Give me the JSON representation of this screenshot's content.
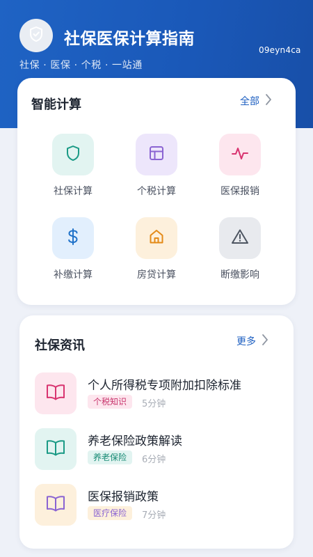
{
  "header": {
    "title": "社保医保计算指南",
    "subtitle": "社保 · 医保 · 个税 · 一站通",
    "app_id": "09eyn4ca",
    "logo_icon": "shield-icon"
  },
  "smart_calc": {
    "title": "智能计算",
    "more_label": "全部",
    "items": [
      {
        "label": "社保计算",
        "icon": "shield-icon",
        "color": "#1a9a85",
        "bg": "#e2f4f1"
      },
      {
        "label": "个税计算",
        "icon": "grid-icon",
        "color": "#8a63d2",
        "bg": "#ede6fb"
      },
      {
        "label": "医保报销",
        "icon": "pulse-icon",
        "color": "#d8336f",
        "bg": "#fde6ee"
      },
      {
        "label": "补缴计算",
        "icon": "dollar-icon",
        "color": "#2072c9",
        "bg": "#e2effd"
      },
      {
        "label": "房贷计算",
        "icon": "home-icon",
        "color": "#e48a17",
        "bg": "#fdf0dc"
      },
      {
        "label": "断缴影响",
        "icon": "warning-icon",
        "color": "#4d5561",
        "bg": "#e8eaee"
      }
    ]
  },
  "news": {
    "title": "社保资讯",
    "more_label": "更多",
    "items": [
      {
        "title": "个人所得税专项附加扣除标准",
        "tag": "个税知识",
        "read_time": "5分钟",
        "icon": "book-icon",
        "color": "#d8336f",
        "bg": "#fde6ee",
        "tag_color": "#c8346c",
        "tag_bg": "#fde6ee"
      },
      {
        "title": "养老保险政策解读",
        "tag": "养老保险",
        "read_time": "6分钟",
        "icon": "book-icon",
        "color": "#1a9a85",
        "bg": "#e2f4f1",
        "tag_color": "#178a74",
        "tag_bg": "#e2f4f1"
      },
      {
        "title": "医保报销政策",
        "tag": "医疗保险",
        "read_time": "7分钟",
        "icon": "book-icon",
        "color": "#8a63d2",
        "bg": "#fdf0dc",
        "tag_color": "#8a63d2",
        "tag_bg": "#fdf0dc"
      }
    ]
  }
}
